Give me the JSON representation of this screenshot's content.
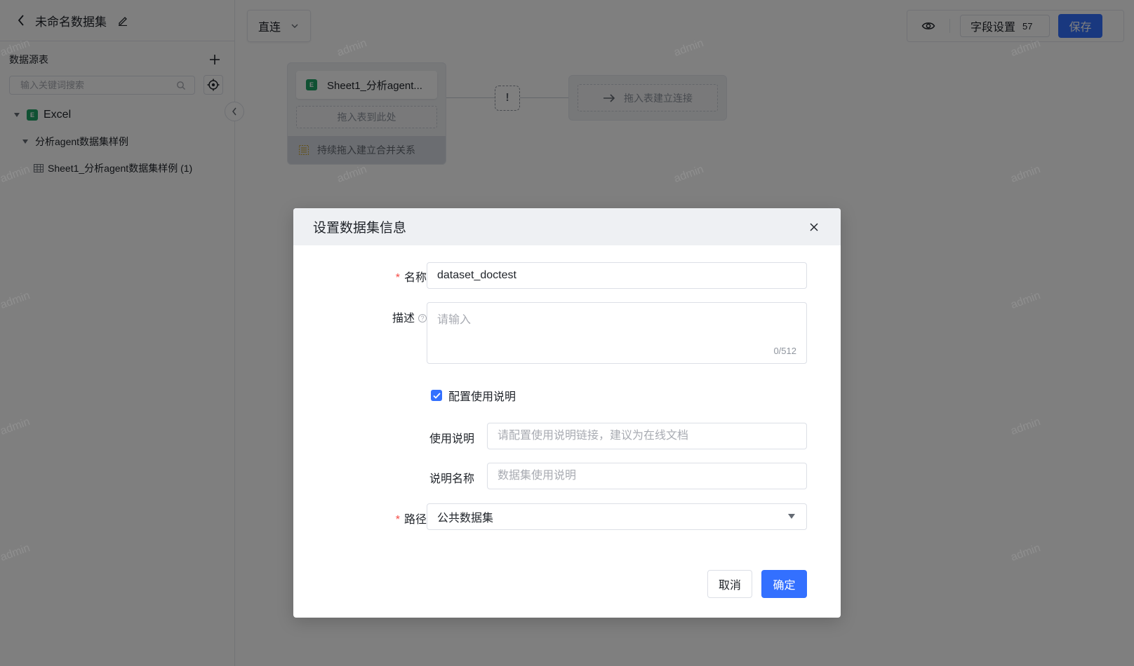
{
  "header": {
    "title": "未命名数据集"
  },
  "sidebar": {
    "section_label": "数据源表",
    "search_placeholder": "输入关键词搜索",
    "tree": {
      "root_label": "Excel",
      "group_label": "分析agent数据集样例",
      "table_label": "Sheet1_分析agent数据集样例 (1)"
    }
  },
  "toolbar": {
    "mode_label": "直连",
    "field_settings_label": "字段设置",
    "field_count": "57",
    "save_label": "保存"
  },
  "canvas": {
    "node_title": "Sheet1_分析agent...",
    "node_drop_label": "拖入表到此处",
    "node_footer_label": "持续拖入建立合并关系",
    "warning_glyph": "!",
    "link_drop_label": "拖入表建立连接"
  },
  "watermark": "admin",
  "dialog": {
    "title": "设置数据集信息",
    "name_label": "名称",
    "name_value": "dataset_doctest",
    "desc_label": "描述",
    "desc_placeholder": "请输入",
    "desc_counter": "0/512",
    "usage_checkbox_label": "配置使用说明",
    "usage_checked": true,
    "usage_label": "使用说明",
    "usage_placeholder": "请配置使用说明链接，建议为在线文档",
    "usage_name_label": "说明名称",
    "usage_name_placeholder": "数据集使用说明",
    "path_label": "路径",
    "path_value": "公共数据集",
    "cancel_label": "取消",
    "ok_label": "确定"
  },
  "colors": {
    "primary": "#3370ff",
    "required": "#f54a45",
    "excel": "#21a366"
  }
}
